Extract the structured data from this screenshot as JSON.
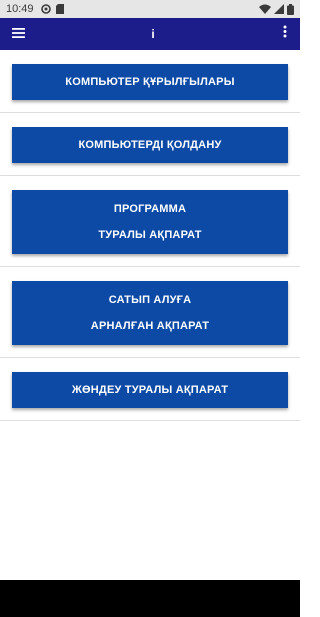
{
  "status_bar": {
    "time": "10:49",
    "left_icons": [
      "data-saver-icon",
      "sim-card-icon"
    ],
    "right_icons": [
      "wifi-icon",
      "cell-signal-icon",
      "battery-icon"
    ]
  },
  "app_bar": {
    "title": "i",
    "background": "#1c1c8a",
    "menu_icon": "hamburger-menu-icon",
    "more_icon": "more-vert-icon"
  },
  "buttons": [
    {
      "lines": [
        "КОМПЬЮТЕР ҚҰРЫЛҒЫЛАРЫ"
      ]
    },
    {
      "lines": [
        "КОМПЬЮТЕРДІ ҚОЛДАНУ"
      ]
    },
    {
      "lines": [
        "ПРОГРАММА",
        "ТУРАЛЫ АҚПАРАТ"
      ]
    },
    {
      "lines": [
        "САТЫП АЛУҒА",
        "АРНАЛҒАН АҚПАРАТ"
      ]
    },
    {
      "lines": [
        "ЖӨНДЕУ ТУРАЛЫ АҚПАРАТ"
      ]
    }
  ],
  "colors": {
    "button": "#0c4aa6",
    "button_text": "#ffffff",
    "divider": "#dedede"
  }
}
